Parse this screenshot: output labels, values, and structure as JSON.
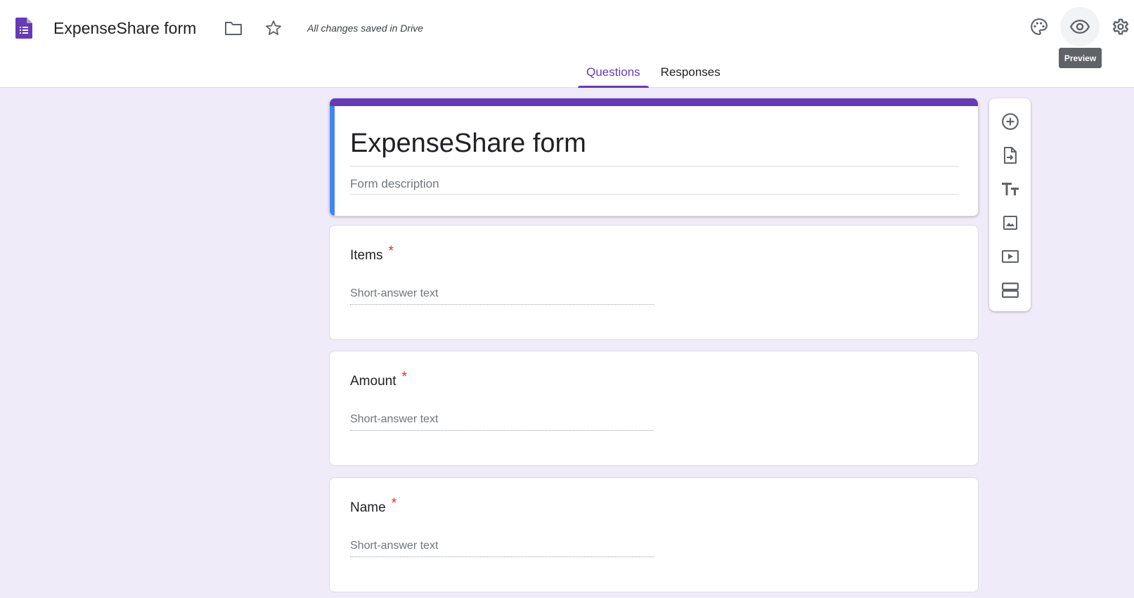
{
  "header": {
    "doc_title": "ExpenseShare form",
    "save_status": "All changes saved in Drive",
    "tooltip": "Preview",
    "icons": [
      "forms-app-icon",
      "folder-icon",
      "star-icon",
      "palette-icon",
      "eye-icon",
      "gear-icon"
    ]
  },
  "tabs": [
    {
      "label": "Questions",
      "active": true
    },
    {
      "label": "Responses",
      "active": false
    }
  ],
  "form": {
    "title": "ExpenseShare form",
    "description_placeholder": "Form description",
    "questions": [
      {
        "title": "Items",
        "required_mark": "*",
        "placeholder": "Short-answer text"
      },
      {
        "title": "Amount",
        "required_mark": "*",
        "placeholder": "Short-answer text"
      },
      {
        "title": "Name",
        "required_mark": "*",
        "placeholder": "Short-answer text"
      }
    ]
  },
  "toolbar": {
    "tools": [
      "add-question-icon",
      "import-questions-icon",
      "add-title-icon",
      "add-image-icon",
      "add-video-icon",
      "add-section-icon"
    ]
  },
  "colors": {
    "accent": "#673ab7",
    "left_accent": "#4285f4",
    "background": "#f0ebf8",
    "required": "#d93025"
  }
}
